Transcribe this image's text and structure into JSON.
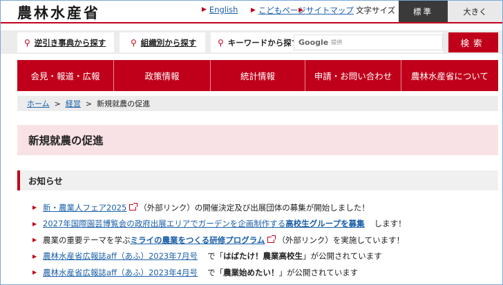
{
  "header": {
    "logo": "農林水産省",
    "links": {
      "english": "English",
      "kids": "こどもページ",
      "sitemap": "サイトマップ"
    },
    "font_size_label": "文字サイズ",
    "font_size_standard": "標準",
    "font_size_large": "大きく"
  },
  "search": {
    "reverse_lookup": "逆引き事典から探す",
    "by_org": "組織別から探す",
    "keyword": "キーワードから探す",
    "google_label": "Google",
    "google_sub": "提供",
    "button": "検索"
  },
  "nav": {
    "items": [
      "会見・報道・広報",
      "政策情報",
      "統計情報",
      "申請・お問い合わせ",
      "農林水産省について"
    ]
  },
  "breadcrumb": {
    "home": "ホーム",
    "parent": "経営",
    "current": "新規就農の促進"
  },
  "page": {
    "title": "新規就農の促進"
  },
  "notices": {
    "heading": "お知らせ",
    "items": [
      {
        "link": "新・農業人フェア2025",
        "rest": "（外部リンク）の開催決定及び出展団体の募集が開始しました！"
      },
      {
        "link": "2027年国際園芸博覧会の政府出展エリアでガーデンを企画制作する",
        "bold": "高校生グループを募集",
        "rest": "します！"
      },
      {
        "pre": "農業の重要テーマを学ぶ",
        "link": "ミライの農業をつくる研修プログラム",
        "rest": "（外部リンク）を実施しています！"
      },
      {
        "link": "農林水産省広報誌aff（あふ）2023年7月号",
        "pre2": "で「",
        "bold": "はばたけ！農業高校生",
        "rest": "」が公開されています"
      },
      {
        "link": "農林水産省広報誌aff（あふ）2023年4月号",
        "pre2": "で「",
        "bold": "農業始めたい！",
        "rest": "」が公開されています"
      }
    ]
  },
  "colors": {
    "brand": "#c0001a",
    "link": "#1a5ea8",
    "title_band": "#f9e2e6"
  }
}
